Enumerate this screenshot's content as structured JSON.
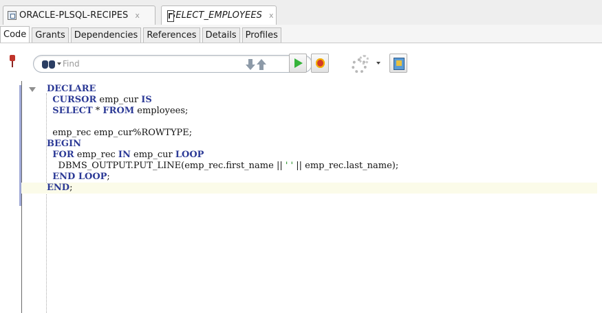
{
  "doc_tabs": [
    {
      "label": "ORACLE-PLSQL-RECIPES",
      "close": "x"
    },
    {
      "label": "SELECT_EMPLOYEES",
      "close": "x"
    }
  ],
  "sub_tabs": [
    "Code",
    "Grants",
    "Dependencies",
    "References",
    "Details",
    "Profiles"
  ],
  "active_sub_tab": "Code",
  "toolbar": {
    "find_placeholder": "Find"
  },
  "icons": {
    "pin": "pin-icon",
    "find": "binoculars-icon",
    "prev": "arrow-down-icon",
    "next": "arrow-up-icon",
    "run": "run-icon",
    "debug": "debug-icon",
    "gear": "gear-icon",
    "compile": "compile-icon"
  },
  "colors": {
    "keyword": "#2c3a96",
    "current_line": "#fbfbe9",
    "run_green": "#35b33a"
  },
  "code": {
    "lines": [
      [
        {
          "t": "DECLARE",
          "k": true
        }
      ],
      [
        {
          "t": "  "
        },
        {
          "t": "CURSOR",
          "k": true
        },
        {
          "t": " emp_cur "
        },
        {
          "t": "IS",
          "k": true
        }
      ],
      [
        {
          "t": "  "
        },
        {
          "t": "SELECT",
          "k": true
        },
        {
          "t": " * "
        },
        {
          "t": "FROM",
          "k": true
        },
        {
          "t": " employees;"
        }
      ],
      [
        {
          "t": ""
        }
      ],
      [
        {
          "t": "  emp_rec emp_cur%ROWTYPE;"
        }
      ],
      [
        {
          "t": "BEGIN",
          "k": true
        }
      ],
      [
        {
          "t": "  "
        },
        {
          "t": "FOR",
          "k": true
        },
        {
          "t": " emp_rec "
        },
        {
          "t": "IN",
          "k": true
        },
        {
          "t": " emp_cur "
        },
        {
          "t": "LOOP",
          "k": true
        }
      ],
      [
        {
          "t": "    DBMS_OUTPUT.PUT_LINE(emp_rec.first_name || "
        },
        {
          "t": "' '",
          "s": true
        },
        {
          "t": " || emp_rec.last_name);"
        }
      ],
      [
        {
          "t": "  "
        },
        {
          "t": "END LOOP",
          "k": true
        },
        {
          "t": ";"
        }
      ],
      [
        {
          "t": "END",
          "k": true
        },
        {
          "t": ";"
        }
      ]
    ],
    "current_line": 9
  }
}
